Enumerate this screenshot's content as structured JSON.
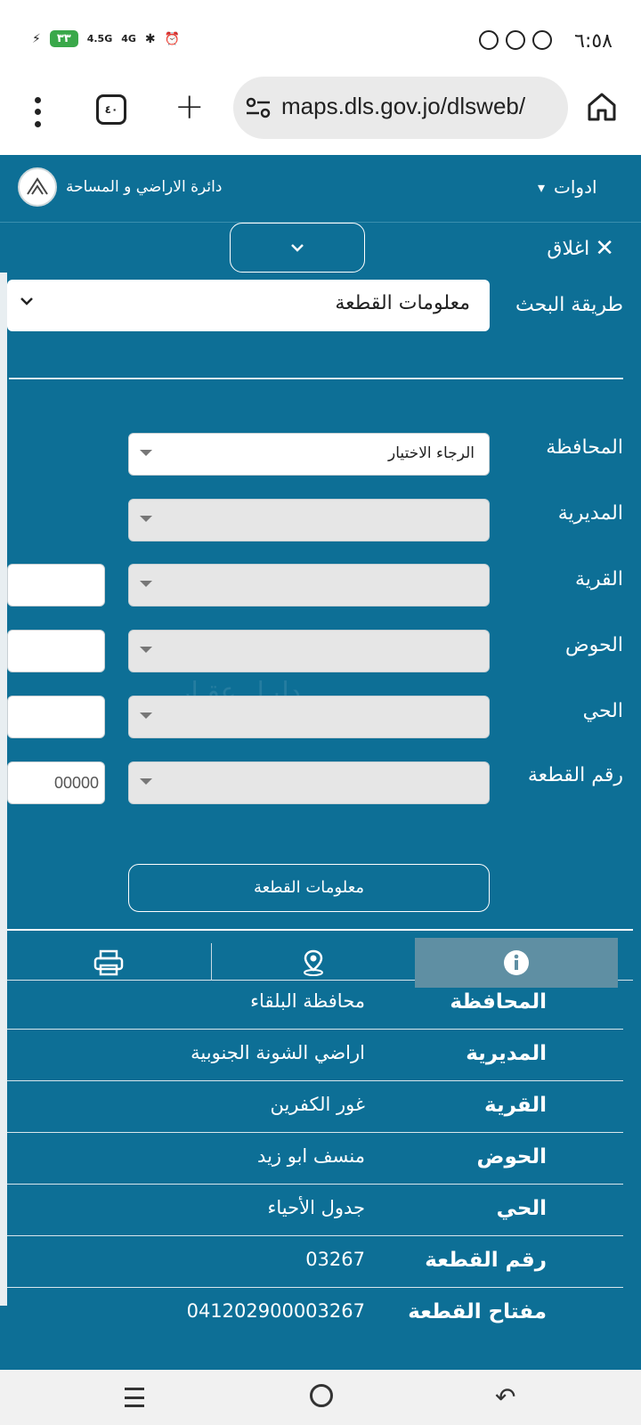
{
  "status_bar": {
    "time": "٦:٥٨",
    "battery": "٣٣",
    "signal_1": "4.5G",
    "signal_2": "4G"
  },
  "browser": {
    "url": "maps.dls.gov.jo/dlsweb/",
    "tab_count": "٤٠"
  },
  "header": {
    "tools_label": "ادوات",
    "brand_name": "دائرة الاراضي و المساحة"
  },
  "panel": {
    "close_label": "اغلاق",
    "search_method_label": "طريقة البحث",
    "search_method_value": "معلومات القطعة",
    "fields": [
      {
        "label": "المحافظة",
        "value": "الرجاء الاختيار"
      },
      {
        "label": "المديرية",
        "value": ""
      },
      {
        "label": "القرية",
        "value": "",
        "box": ""
      },
      {
        "label": "الحوض",
        "value": "",
        "box": ""
      },
      {
        "label": "الحي",
        "value": "",
        "box": ""
      },
      {
        "label": "رقم القطعة",
        "value": "",
        "box": "00000"
      }
    ],
    "submit_label": "معلومات القطعة",
    "watermark": "دليـل عقـار"
  },
  "info": [
    {
      "label": "المحافظة",
      "value": "محافظة البلقاء"
    },
    {
      "label": "المديرية",
      "value": "اراضي الشونة الجنوبية"
    },
    {
      "label": "القرية",
      "value": "غور الكفرين"
    },
    {
      "label": "الحوض",
      "value": "منسف ابو زيد"
    },
    {
      "label": "الحي",
      "value": "جدول الأحياء"
    },
    {
      "label": "رقم القطعة",
      "value": "03267"
    },
    {
      "label": "مفتاح القطعة",
      "value": "041202900003267"
    }
  ],
  "colors": {
    "panel_bg": "#0d6f96",
    "active_tab": "#5f8fa3"
  }
}
